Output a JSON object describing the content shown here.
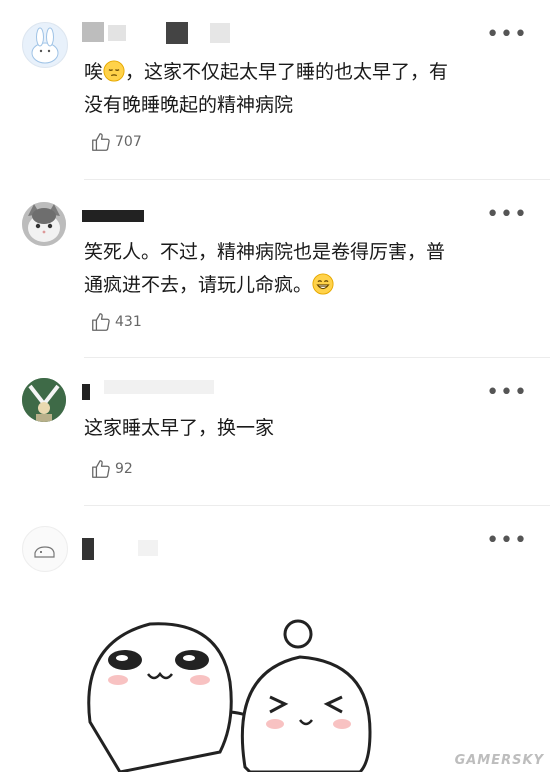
{
  "comments": [
    {
      "text_line1": "唉",
      "text_line1_rest": "，这家不仅起太早了睡的也太早了，有",
      "text_line2": "没有晚睡晚起的精神病院",
      "likes": "707",
      "emoji": "pensive-face"
    },
    {
      "text_line1": "笑死人。不过，精神病院也是卷得厉害，普",
      "text_line2": "通疯进不去，请玩儿命疯。",
      "likes": "431",
      "emoji": "grinning-face"
    },
    {
      "text_line1": "这家睡太早了，换一家",
      "likes": "92"
    },
    {
      "likes": ""
    }
  ],
  "more_glyph": "•••",
  "watermark": "GAMERSKY",
  "colors": {
    "text": "#1a1a1a",
    "meta": "#666666",
    "divider": "#ececec"
  }
}
